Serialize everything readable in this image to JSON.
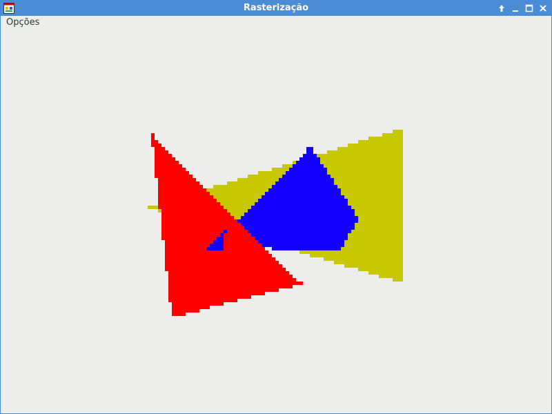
{
  "window": {
    "title": "Rasterização"
  },
  "menubar": {
    "items": [
      {
        "label": "Opções"
      }
    ]
  },
  "titlebar_controls": [
    {
      "name": "keep-above-icon"
    },
    {
      "name": "minimize-icon"
    },
    {
      "name": "maximize-icon"
    },
    {
      "name": "close-icon"
    }
  ],
  "canvas": {
    "background": "#edeeec",
    "shapes": [
      {
        "name": "yellow-triangle",
        "color": "#c8c800"
      },
      {
        "name": "blue-quad",
        "color": "#1400ff"
      },
      {
        "name": "red-triangle",
        "color": "#ff0000"
      },
      {
        "name": "small-blue-triangle",
        "color": "#1400ff"
      }
    ]
  }
}
